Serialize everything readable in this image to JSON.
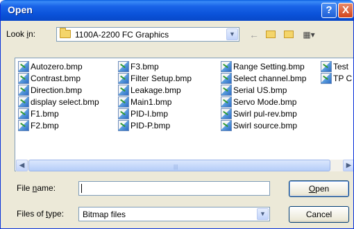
{
  "window": {
    "title": "Open"
  },
  "titlebar": {
    "help": "?",
    "close": "X"
  },
  "lookin": {
    "label_pre": "Look ",
    "label_u": "i",
    "label_post": "n:",
    "value": "1100A-2200 FC Graphics"
  },
  "toolbar": {
    "back": "←",
    "up": "🗠",
    "newfolder": "✨",
    "views": "▦▾"
  },
  "files": [
    [
      "Autozero.bmp",
      "Contrast.bmp",
      "Direction.bmp",
      "display select.bmp",
      "F1.bmp",
      "F2.bmp"
    ],
    [
      "F3.bmp",
      "Filter Setup.bmp",
      "Leakage.bmp",
      "Main1.bmp",
      "PID-I.bmp",
      "PID-P.bmp"
    ],
    [
      "Range Setting.bmp",
      "Select channel.bmp",
      "Serial US.bmp",
      "Servo Mode.bmp",
      "Swirl pul-rev.bmp",
      "Swirl source.bmp"
    ],
    [
      "Test",
      "TP C"
    ]
  ],
  "filename": {
    "label_pre": "File ",
    "label_u": "n",
    "label_post": "ame:",
    "value": ""
  },
  "filetype": {
    "label_pre": "Files of ",
    "label_u": "t",
    "label_post": "ype:",
    "value": "Bitmap files"
  },
  "buttons": {
    "open_u": "O",
    "open_rest": "pen",
    "cancel": "Cancel"
  }
}
